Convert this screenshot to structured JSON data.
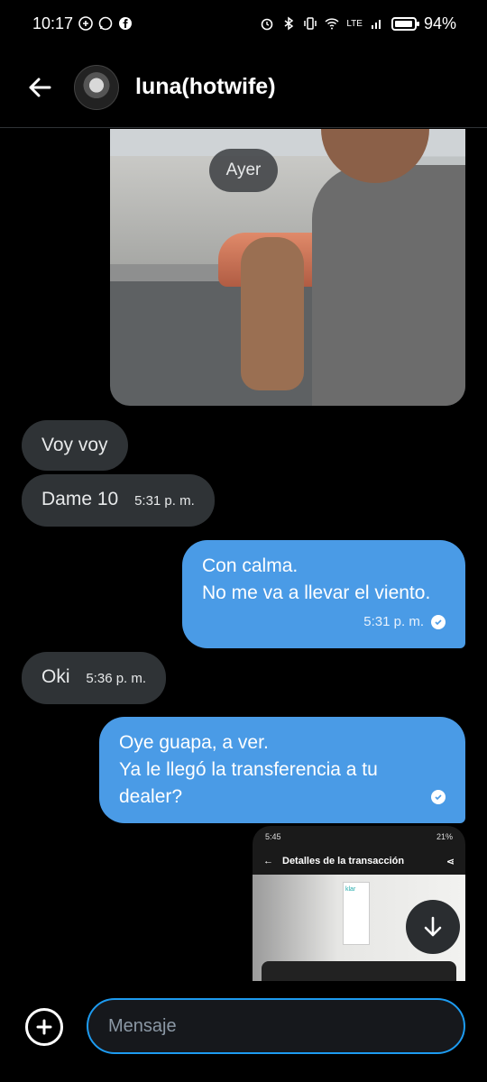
{
  "status_bar": {
    "time": "10:17",
    "battery": "94%",
    "network": "LTE"
  },
  "header": {
    "contact_name": "luna(hotwife)"
  },
  "chat": {
    "date_separator": "Ayer",
    "messages": [
      {
        "direction": "in",
        "text": "Voy voy"
      },
      {
        "direction": "in",
        "text": "Dame 10",
        "time": "5:31 p. m."
      },
      {
        "direction": "out",
        "lines": [
          "Con calma.",
          "No me va a llevar el viento."
        ],
        "time": "5:31 p. m."
      },
      {
        "direction": "in",
        "text": "Oki",
        "time": "5:36 p. m."
      },
      {
        "direction": "out",
        "lines": [
          "Oye guapa, a ver.",
          "Ya le llegó la transferencia a tu",
          "dealer?"
        ]
      }
    ],
    "screenshot": {
      "time": "5:45",
      "battery": "21%",
      "title": "Detalles de la transacción",
      "brand": "klar"
    }
  },
  "composer": {
    "placeholder": "Mensaje"
  },
  "colors": {
    "outgoing_bubble": "#4a9be6",
    "incoming_bubble": "#2f3336",
    "accent": "#1d9bf0"
  }
}
